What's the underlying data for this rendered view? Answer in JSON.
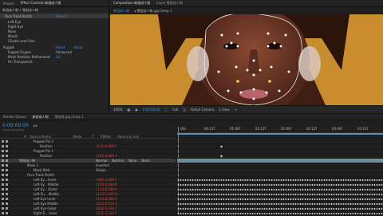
{
  "top_tabs": {
    "project": "Project",
    "effect_controls": "Effect Controls 新组成人物",
    "composition": "Composition 新组成人物",
    "layer": "Layer 雪组成人物"
  },
  "effect_panel": {
    "header": "新组成人物 • 雪组成人物",
    "reset_label": "Reset",
    "about_label": "About",
    "items": [
      {
        "label": "Face Track Points",
        "value": "Reset"
      },
      {
        "label": "Left Eye",
        "value": ""
      },
      {
        "label": "Right Eye",
        "value": ""
      },
      {
        "label": "Nose",
        "value": ""
      },
      {
        "label": "Mouth",
        "value": ""
      },
      {
        "label": "Cheeks and Chin",
        "value": ""
      },
      {
        "label": "Puppet",
        "value": "Reset"
      },
      {
        "label": "Puppet Engine",
        "value": "Advanced"
      },
      {
        "label": "Mesh Rotation Refinement",
        "value": "20"
      },
      {
        "label": "On Transparent",
        "value": ""
      }
    ]
  },
  "comp_panel": {
    "subtabs": [
      "新组成人物",
      "◂ 雪组成人物.jpg Comp 1"
    ],
    "zoom": "100%",
    "timecode": "0:00:00:00",
    "resolution": "Full",
    "camera": "Active Camera",
    "view": "1 View"
  },
  "timeline": {
    "tabs": [
      "Render Queue",
      "新组成人物",
      "雪组成.jpg Comp 1"
    ],
    "timecode": "0:00:00:00",
    "fps_note": "00000 (25.00 fps)",
    "search_placeholder": "ρ▾",
    "col_headers": [
      "#",
      "Source Name",
      "Mode",
      "T",
      "TrkMat",
      "Parent & Link"
    ],
    "ruler_labels": [
      "00s",
      "00:12f",
      "01:00f",
      "01:12f",
      "02:00f",
      "02:12f",
      "03:00f",
      "03:12f"
    ],
    "rows": [
      {
        "label": "Puppet Pin 2",
        "value": "",
        "indent": 22
      },
      {
        "label": "Position",
        "value": "1131.8,369.7",
        "indent": 30
      },
      {
        "label": "Puppet Pin 1",
        "value": "",
        "indent": 22
      },
      {
        "label": "Position",
        "value": "1105.8,369.7",
        "indent": 30
      },
      {
        "label": "雪组成人物",
        "value": "Normal",
        "indent": 4
      },
      {
        "label": "Mask 1",
        "value": "Inverted",
        "indent": 14
      },
      {
        "label": "Mask Path",
        "value": "Shape...",
        "indent": 22
      },
      {
        "label": "Face Track Points",
        "value": "",
        "indent": 14
      },
      {
        "label": "Left Ey... Inner",
        "value": "1040.3,369.7",
        "indent": 22
      },
      {
        "label": "Left Ey... Middle",
        "value": "1150.6,294.8",
        "indent": 22
      },
      {
        "label": "Left Ey... Outer",
        "value": "1114.8,266.9",
        "indent": 22
      },
      {
        "label": "Left Pu... Middle",
        "value": "1113.5,297.9",
        "indent": 22
      },
      {
        "label": "Left Eye Inner",
        "value": "1104.8,386.0",
        "indent": 22
      },
      {
        "label": "Left Eye Middle",
        "value": "1101.8,313.3",
        "indent": 22
      },
      {
        "label": "Left Eye Outer",
        "value": "1064.6,330.7",
        "indent": 22
      },
      {
        "label": "Right E... Inner",
        "value": "1131.3,334.7",
        "indent": 22
      }
    ],
    "mode_options": {
      "mode": "Normal",
      "trkmat": "None",
      "parent": "None"
    }
  },
  "colors": {
    "accent": "#3d8fd9",
    "value_red": "#d84a3a",
    "face_bg": "#c98d2f",
    "work_area": "#5a8fb8"
  }
}
